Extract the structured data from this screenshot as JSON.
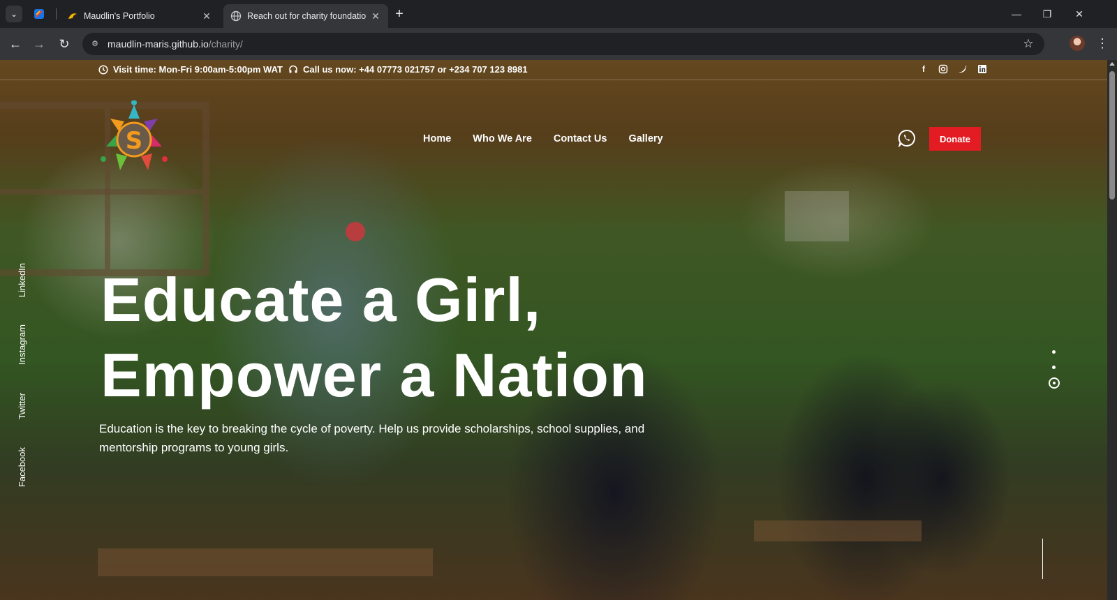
{
  "browser": {
    "tabs": [
      {
        "title": "Maudlin's Portfolio"
      },
      {
        "title": "Reach out for charity foundation"
      }
    ],
    "url_host": "maudlin-maris.github.io",
    "url_path": "/charity/"
  },
  "topbar": {
    "visit_time": "Visit time: Mon-Fri 9:00am-5:00pm WAT",
    "call_us": "Call us now: +44 07773 021757 or +234 707 123 8981",
    "social_icons": [
      "facebook-icon",
      "instagram-icon",
      "twitter-icon",
      "linkedin-icon"
    ]
  },
  "logo": {
    "letter": "S"
  },
  "nav": {
    "items": [
      "Home",
      "Who We Are",
      "Contact Us",
      "Gallery"
    ],
    "donate_label": "Donate"
  },
  "hero": {
    "title_line1": "Educate a Girl,",
    "title_line2": "Empower a Nation",
    "subtitle": "Education is the key to breaking the cycle of poverty. Help us provide scholarships, school supplies, and mentorship programs to young girls."
  },
  "side_socials": [
    "LinkedIn",
    "Instagram",
    "Twitter",
    "Facebook"
  ],
  "slider": {
    "count": 3,
    "active_index": 2
  },
  "colors": {
    "accent": "#e31b23",
    "text": "#ffffff"
  }
}
